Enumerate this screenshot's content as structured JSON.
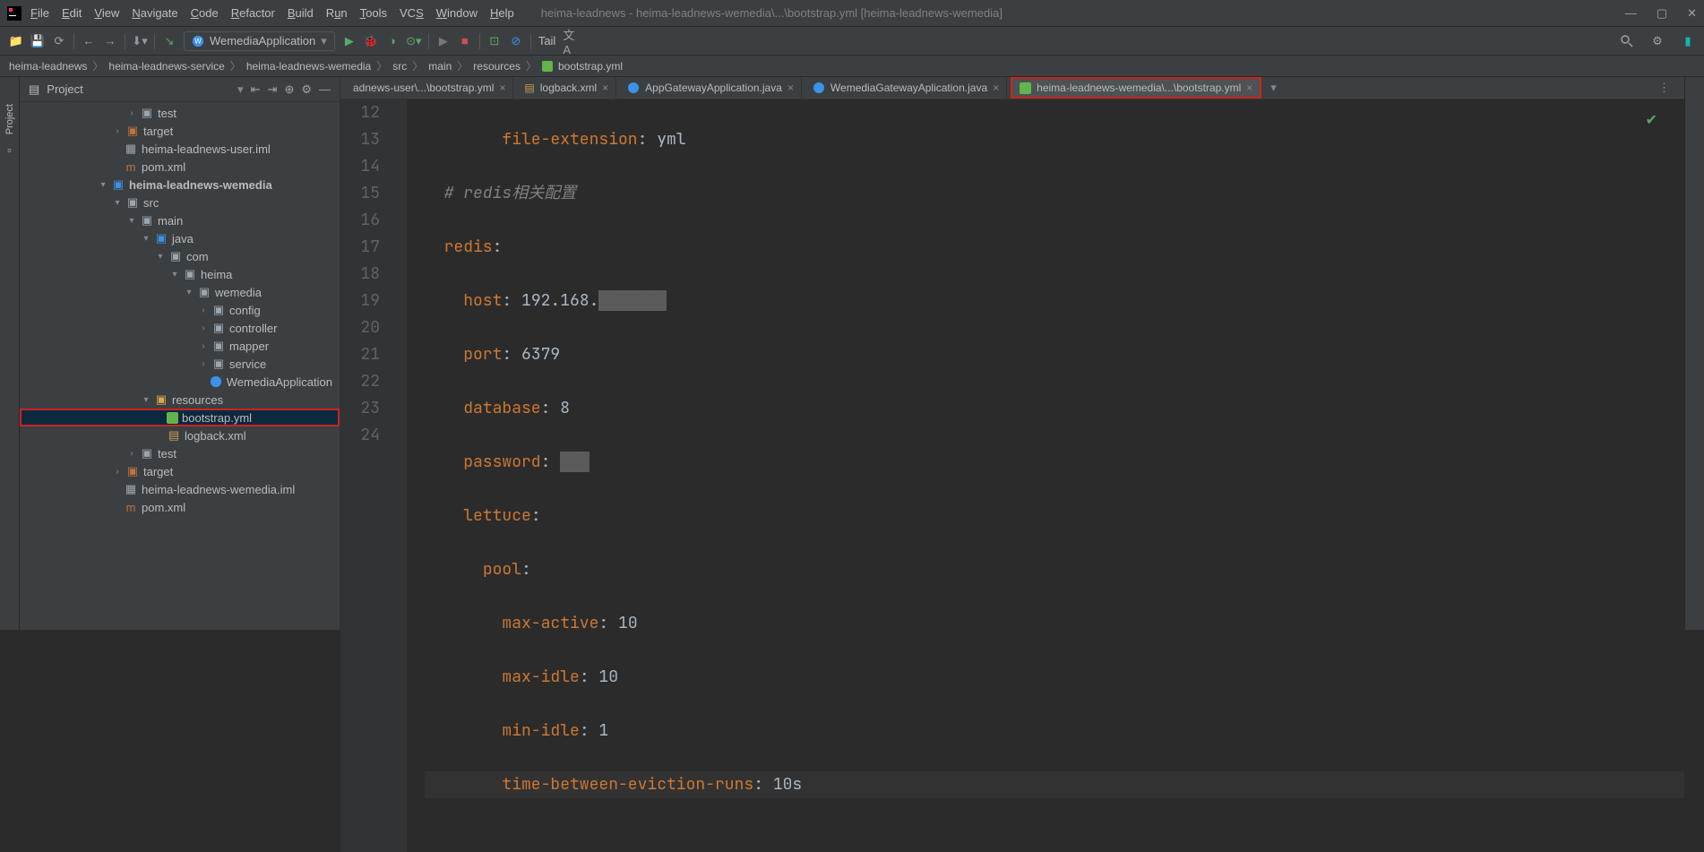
{
  "title": "heima-leadnews - heima-leadnews-wemedia\\...\\bootstrap.yml [heima-leadnews-wemedia]",
  "menu": {
    "file": "File",
    "edit": "Edit",
    "view": "View",
    "navigate": "Navigate",
    "code": "Code",
    "refactor": "Refactor",
    "build": "Build",
    "run": "Run",
    "tools": "Tools",
    "vcs": "VCS",
    "window": "Window",
    "help": "Help"
  },
  "run_config": "WemediaApplication",
  "tail": "Tail",
  "breadcrumb": {
    "c0": "heima-leadnews",
    "c1": "heima-leadnews-service",
    "c2": "heima-leadnews-wemedia",
    "c3": "src",
    "c4": "main",
    "c5": "resources",
    "c6": "bootstrap.yml"
  },
  "project": {
    "title": "Project",
    "tree": {
      "test": "test",
      "target1": "target",
      "iml_user": "heima-leadnews-user.iml",
      "pom1": "pom.xml",
      "wemedia": "heima-leadnews-wemedia",
      "src": "src",
      "main": "main",
      "java": "java",
      "com": "com",
      "heima": "heima",
      "wemedia_pkg": "wemedia",
      "config": "config",
      "controller": "controller",
      "mapper": "mapper",
      "service": "service",
      "wemedia_app": "WemediaApplication",
      "resources": "resources",
      "bootstrap": "bootstrap.yml",
      "logback": "logback.xml",
      "test2": "test",
      "target2": "target",
      "iml_wemedia": "heima-leadnews-wemedia.iml",
      "pom2": "pom.xml"
    }
  },
  "tabs": {
    "t0": "adnews-user\\...\\bootstrap.yml",
    "t1": "logback.xml",
    "t2": "AppGatewayApplication.java",
    "t3": "WemediaGatewayAplication.java",
    "t4": "heima-leadnews-wemedia\\...\\bootstrap.yml"
  },
  "code": {
    "lines": [
      "12",
      "13",
      "14",
      "15",
      "16",
      "17",
      "18",
      "19",
      "20",
      "21",
      "22",
      "23",
      "24"
    ],
    "l12_k": "file-extension",
    "l12_v": "yml",
    "l13_c": "# redis相关配置",
    "l14_k": "redis",
    "l15_k": "host",
    "l15_v": "192.168.",
    "l16_k": "port",
    "l16_v": "6379",
    "l17_k": "database",
    "l17_v": "8",
    "l18_k": "password",
    "l19_k": "lettuce",
    "l20_k": "pool",
    "l21_k": "max-active",
    "l21_v": "10",
    "l22_k": "max-idle",
    "l22_v": "10",
    "l23_k": "min-idle",
    "l23_v": "1",
    "l24_k": "time-between-eviction-runs",
    "l24_v": "10s"
  }
}
